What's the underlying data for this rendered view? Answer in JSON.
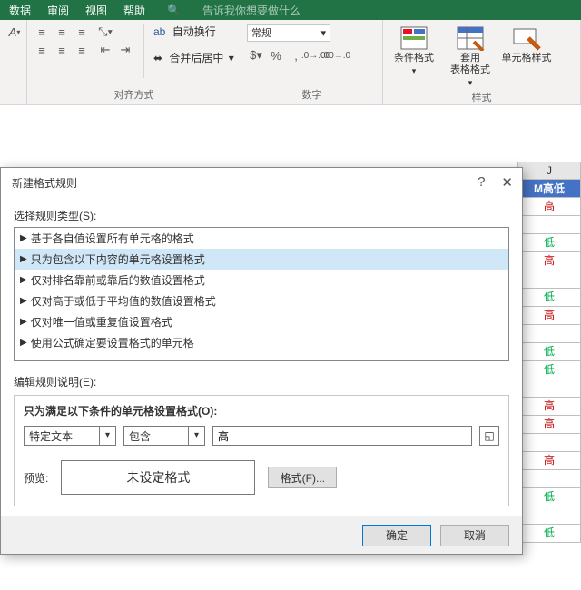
{
  "ribbon": {
    "tabs": [
      "数据",
      "审阅",
      "视图",
      "帮助"
    ],
    "tellme": "告诉我你想要做什么",
    "autowrap": "自动换行",
    "merge": "合并后居中",
    "align_group": "对齐方式",
    "number_group": "数字",
    "style_group": "样式",
    "num_format": "常规",
    "cond_fmt": "条件格式",
    "table_fmt": "套用\n表格格式",
    "cell_style": "单元格样式"
  },
  "sheet": {
    "col_letter": "J",
    "band": "M高低",
    "rows": [
      {
        "v": "高",
        "c": "red"
      },
      {
        "v": "",
        "c": ""
      },
      {
        "v": "低",
        "c": "green"
      },
      {
        "v": "高",
        "c": "red"
      },
      {
        "v": "",
        "c": ""
      },
      {
        "v": "低",
        "c": "green"
      },
      {
        "v": "高",
        "c": "red"
      },
      {
        "v": "",
        "c": ""
      },
      {
        "v": "低",
        "c": "green"
      },
      {
        "v": "低",
        "c": "green"
      },
      {
        "v": "",
        "c": ""
      },
      {
        "v": "高",
        "c": "red"
      },
      {
        "v": "高",
        "c": "red"
      },
      {
        "v": "",
        "c": ""
      },
      {
        "v": "高",
        "c": "red"
      },
      {
        "v": "",
        "c": ""
      },
      {
        "v": "低",
        "c": "green"
      },
      {
        "v": "",
        "c": ""
      },
      {
        "v": "低",
        "c": "green"
      }
    ]
  },
  "dialog": {
    "title": "新建格式规则",
    "help": "?",
    "select_type": "选择规则类型(S):",
    "rules": [
      "基于各自值设置所有单元格的格式",
      "只为包含以下内容的单元格设置格式",
      "仅对排名靠前或靠后的数值设置格式",
      "仅对高于或低于平均值的数值设置格式",
      "仅对唯一值或重复值设置格式",
      "使用公式确定要设置格式的单元格"
    ],
    "selected_rule_index": 1,
    "edit_desc": "编辑规则说明(E):",
    "cond_header": "只为满足以下条件的单元格设置格式(O):",
    "combo1": "特定文本",
    "combo2": "包含",
    "value": "高",
    "preview_label": "预览:",
    "preview_text": "未设定格式",
    "format_btn": "格式(F)...",
    "ok": "确定",
    "cancel": "取消"
  }
}
